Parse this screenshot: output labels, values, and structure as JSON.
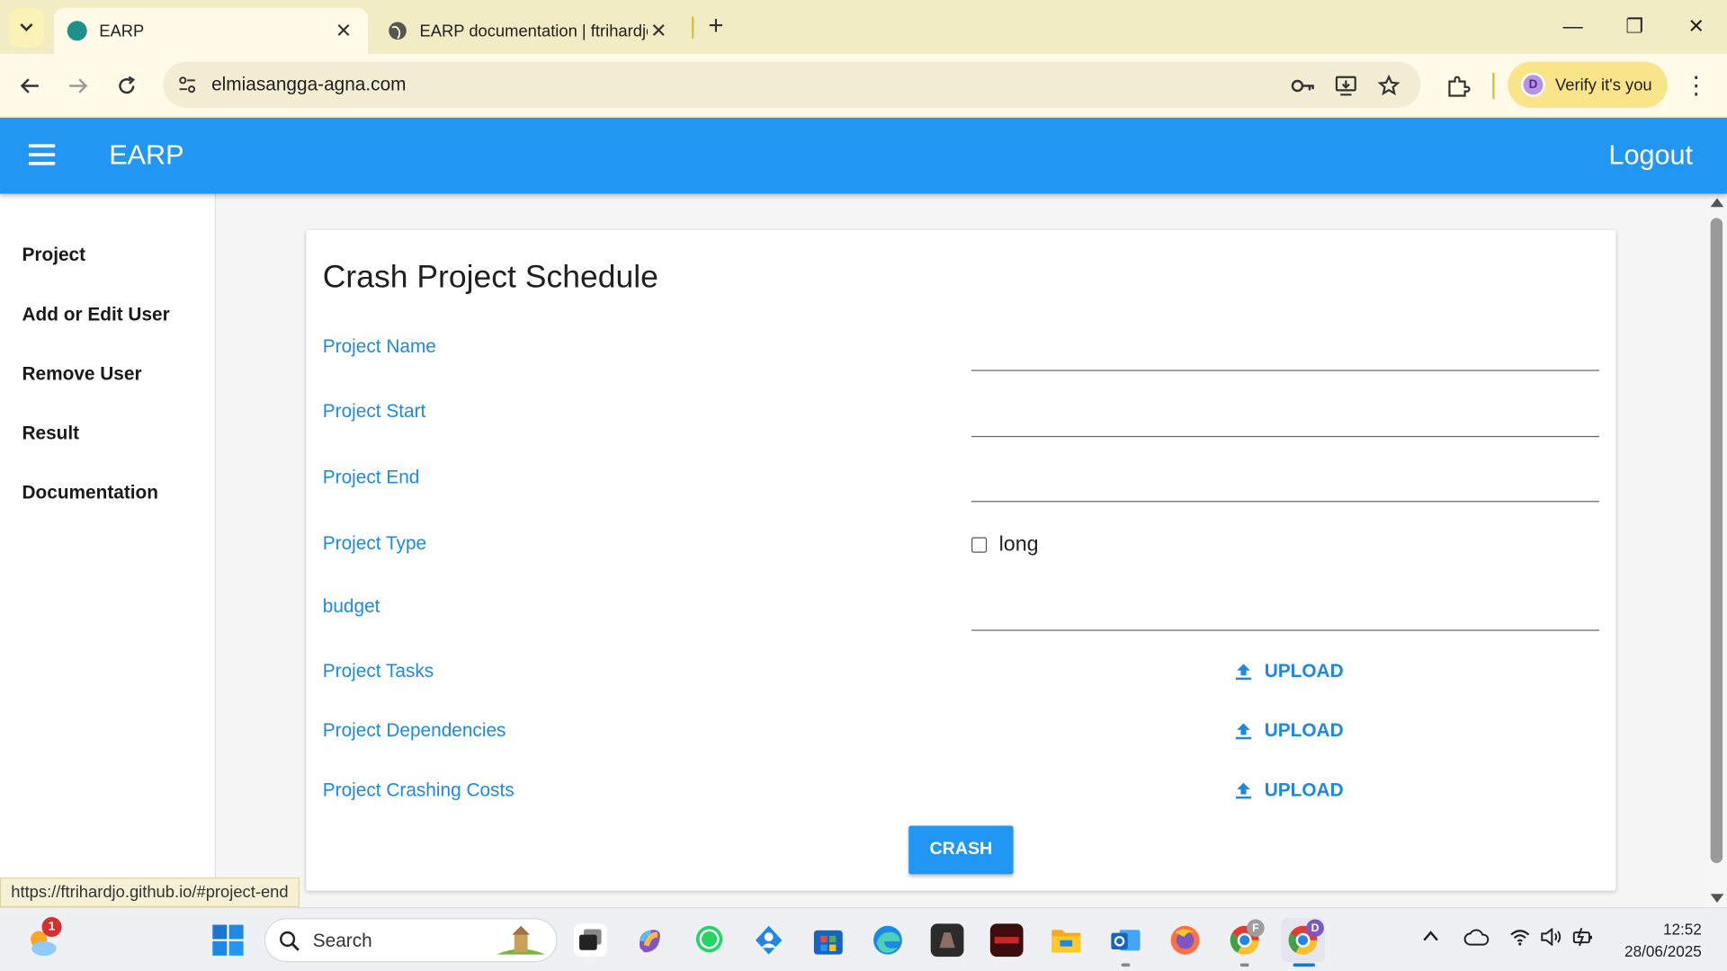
{
  "browser": {
    "tabs": [
      {
        "title": "EARP",
        "active": true
      },
      {
        "title": "EARP documentation | ftrihardjo",
        "active": false
      }
    ],
    "new_tab_label": "+",
    "window_controls": {
      "minimize": "—",
      "restore": "❐",
      "close": "✕"
    },
    "url": "elmiasangga-agna.com",
    "profile": {
      "initial": "D",
      "label": "Verify it's you"
    },
    "status_url": "https://ftrihardjo.github.io/#project-end"
  },
  "app": {
    "brand": "EARP",
    "logout_label": "Logout",
    "sidebar": {
      "items": [
        {
          "label": "Project"
        },
        {
          "label": "Add or Edit User"
        },
        {
          "label": "Remove User"
        },
        {
          "label": "Result"
        },
        {
          "label": "Documentation"
        }
      ]
    },
    "form": {
      "title": "Crash Project Schedule",
      "fields": {
        "project_name": {
          "label": "Project Name",
          "value": ""
        },
        "project_start": {
          "label": "Project Start",
          "value": ""
        },
        "project_end": {
          "label": "Project End",
          "value": ""
        },
        "project_type": {
          "label": "Project Type",
          "checkbox_label": "long",
          "checked": false
        },
        "budget": {
          "label": "budget",
          "value": ""
        },
        "project_tasks": {
          "label": "Project Tasks",
          "button": "UPLOAD"
        },
        "project_dependencies": {
          "label": "Project Dependencies",
          "button": "UPLOAD"
        },
        "project_crashing_costs": {
          "label": "Project Crashing Costs",
          "button": "UPLOAD"
        }
      },
      "submit_label": "CRASH"
    },
    "colors": {
      "primary": "#2196f3",
      "label": "#1e88e5"
    }
  },
  "taskbar": {
    "weather_badge": "1",
    "search_placeholder": "Search",
    "chrome_profile_badges": [
      "F",
      "D"
    ],
    "clock": {
      "time": "12:52",
      "date": "28/06/2025"
    }
  }
}
